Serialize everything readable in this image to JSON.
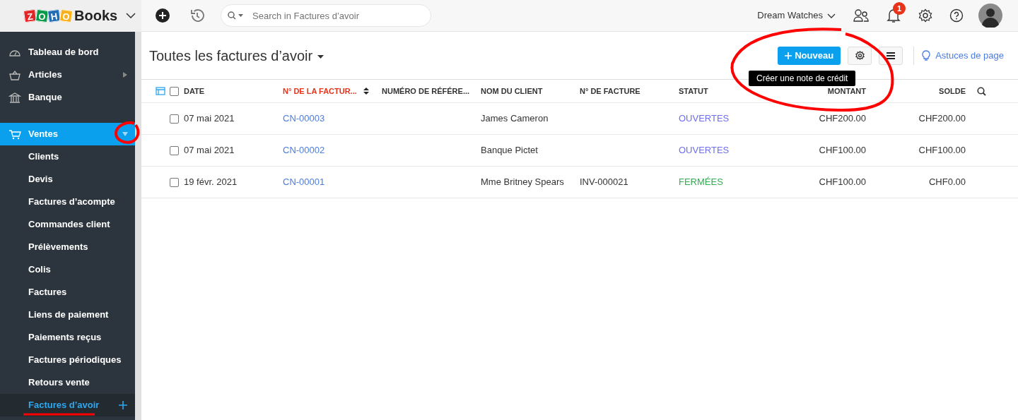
{
  "topbar": {
    "logo_letters": [
      "Z",
      "O",
      "H",
      "O"
    ],
    "logo_word": "Books",
    "search": {
      "placeholder": "Search in Factures d’avoir"
    },
    "organization": "Dream Watches",
    "notification_count": "1"
  },
  "sidebar": {
    "items": [
      {
        "label": "Tableau de bord",
        "kind": "link",
        "selected": false
      },
      {
        "label": "Articles",
        "kind": "group",
        "expanded": false,
        "selected": false
      },
      {
        "label": "Banque",
        "kind": "link",
        "selected": false
      },
      {
        "label": "Ventes",
        "kind": "group",
        "expanded": true,
        "selected": true,
        "children": [
          {
            "label": "Clients",
            "selected": false
          },
          {
            "label": "Devis",
            "selected": false
          },
          {
            "label": "Factures d’acompte",
            "selected": false
          },
          {
            "label": "Commandes client",
            "selected": false
          },
          {
            "label": "Prélèvements",
            "selected": false
          },
          {
            "label": "Colis",
            "selected": false
          },
          {
            "label": "Factures",
            "selected": false
          },
          {
            "label": "Liens de paiement",
            "selected": false
          },
          {
            "label": "Paiements reçus",
            "selected": false
          },
          {
            "label": "Factures périodiques",
            "selected": false
          },
          {
            "label": "Retours vente",
            "selected": false
          },
          {
            "label": "Factures d’avoir",
            "selected": true
          }
        ]
      }
    ]
  },
  "page": {
    "title": "Toutes les factures d’avoir",
    "new_button": "Nouveau",
    "tooltip": "Créer une note de crédit",
    "tips_link": "Astuces de page"
  },
  "table": {
    "all_selected": false,
    "columns": [
      {
        "label": "DATE",
        "sorted": false
      },
      {
        "label": "N° DE LA FACTUR...",
        "sorted": true
      },
      {
        "label": "NUMÉRO DE RÉFÉRE...",
        "sorted": false
      },
      {
        "label": "NOM DU CLIENT",
        "sorted": false
      },
      {
        "label": "N° DE FACTURE",
        "sorted": false
      },
      {
        "label": "STATUT",
        "sorted": false
      },
      {
        "label": "MONTANT",
        "sorted": false
      },
      {
        "label": "SOLDE",
        "sorted": false
      }
    ],
    "rows": [
      {
        "checked": false,
        "date": "07 mai 2021",
        "number": "CN-00003",
        "client": "James Cameron",
        "status": "OUVERTES",
        "color": "#6e6ef0",
        "amount": "CHF200.00",
        "balance": "CHF200.00"
      },
      {
        "checked": false,
        "date": "07 mai 2021",
        "number": "CN-00002",
        "client": "Banque Pictet",
        "status": "OUVERTES",
        "color": "#6e6ef0",
        "amount": "CHF100.00",
        "balance": "CHF100.00"
      },
      {
        "checked": false,
        "date": "19 févr. 2021",
        "number": "CN-00001",
        "client": "Mme Britney Spears",
        "invoice": "INV-000021",
        "status": "FERMÉES",
        "color": "#2fae4e",
        "amount": "CHF100.00",
        "balance": "CHF0.00"
      }
    ]
  }
}
